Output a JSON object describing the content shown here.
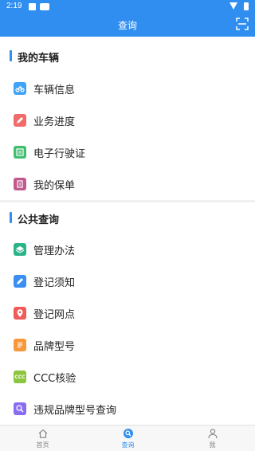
{
  "status_bar": {
    "time": "2:19"
  },
  "app_bar": {
    "title": "查询"
  },
  "sections": [
    {
      "title": "我的车辆",
      "items": [
        {
          "label": "车辆信息",
          "icon": "motorcycle-icon",
          "color": "#3fa3f7"
        },
        {
          "label": "业务进度",
          "icon": "pencil-icon",
          "color": "#f26b6b"
        },
        {
          "label": "电子行驶证",
          "icon": "license-icon",
          "color": "#3fbf6f"
        },
        {
          "label": "我的保单",
          "icon": "policy-icon",
          "color": "#c05a8e"
        }
      ]
    },
    {
      "title": "公共查询",
      "items": [
        {
          "label": "管理办法",
          "icon": "layers-icon",
          "color": "#2bb38a"
        },
        {
          "label": "登记须知",
          "icon": "edit-icon",
          "color": "#3a8ff0"
        },
        {
          "label": "登记网点",
          "icon": "location-pin-icon",
          "color": "#f25a5a"
        },
        {
          "label": "品牌型号",
          "icon": "document-icon",
          "color": "#f7993b"
        },
        {
          "label": "CCC核验",
          "icon": "ccc-icon",
          "color": "#8cc63f"
        },
        {
          "label": "违规品牌型号查询",
          "icon": "search-icon",
          "color": "#8a6cf0"
        }
      ]
    }
  ],
  "nav": [
    {
      "label": "首页",
      "icon": "home-icon"
    },
    {
      "label": "查询",
      "icon": "search-icon"
    },
    {
      "label": "我",
      "icon": "user-icon"
    }
  ],
  "colors": {
    "primary": "#2f8ef0",
    "background": "#f0f0f0"
  }
}
